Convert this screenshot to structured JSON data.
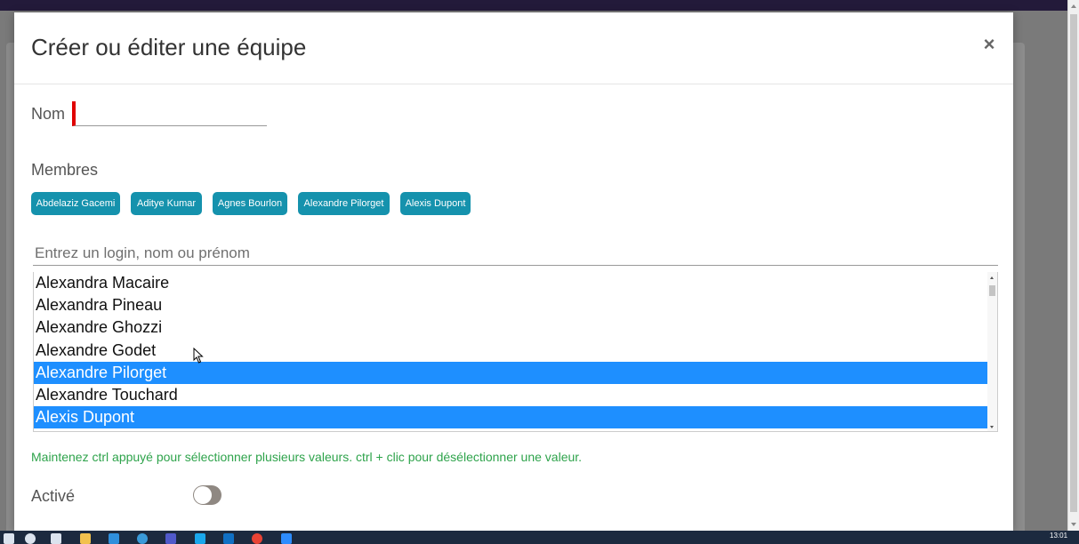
{
  "modal": {
    "title": "Créer ou éditer une équipe",
    "close_label": "×"
  },
  "form": {
    "nom_label": "Nom",
    "nom_value": "",
    "membres_label": "Membres",
    "selected_members": [
      "Abdelaziz Gacemi",
      "Aditye Kumar",
      "Agnes Bourlon",
      "Alexandre Pilorget",
      "Alexis Dupont"
    ],
    "search_placeholder": "Entrez un login, nom ou prénom",
    "options": [
      {
        "label": "Alexandra Macaire",
        "selected": false
      },
      {
        "label": "Alexandra Pineau",
        "selected": false
      },
      {
        "label": "Alexandre Ghozzi",
        "selected": false
      },
      {
        "label": "Alexandre Godet",
        "selected": false
      },
      {
        "label": "Alexandre Pilorget",
        "selected": true
      },
      {
        "label": "Alexandre Touchard",
        "selected": false
      },
      {
        "label": "Alexis Dupont",
        "selected": true
      }
    ],
    "help_text": "Maintenez ctrl appuyé pour sélectionner plusieurs valeurs. ctrl + clic pour désélectionner une valeur.",
    "active_label": "Activé",
    "active_on": false
  },
  "colors": {
    "chip_bg": "#1592ad",
    "selected_option_bg": "#1e8fff",
    "help_text": "#2ea34b",
    "required_marker": "#e00000"
  },
  "taskbar": {
    "time": "13:01",
    "icons": [
      "start-icon",
      "search-icon",
      "task-view-icon",
      "file-explorer-icon",
      "edge-icon",
      "browser-icon",
      "teams-icon",
      "skype-icon",
      "outlook-icon",
      "chrome-icon",
      "zoom-icon"
    ]
  }
}
